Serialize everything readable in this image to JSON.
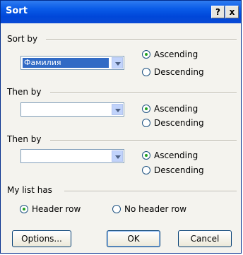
{
  "window": {
    "title": "Sort",
    "help_label": "?",
    "close_label": "x"
  },
  "sections": [
    {
      "label": "Sort by",
      "value": "Фамилия",
      "ascending": "Ascending",
      "descending": "Descending"
    },
    {
      "label": "Then by",
      "value": "",
      "ascending": "Ascending",
      "descending": "Descending"
    },
    {
      "label": "Then by",
      "value": "",
      "ascending": "Ascending",
      "descending": "Descending"
    }
  ],
  "header": {
    "label": "My list has",
    "header_row": "Header row",
    "no_header_row": "No header row"
  },
  "buttons": {
    "options": "Options...",
    "ok": "OK",
    "cancel": "Cancel"
  }
}
